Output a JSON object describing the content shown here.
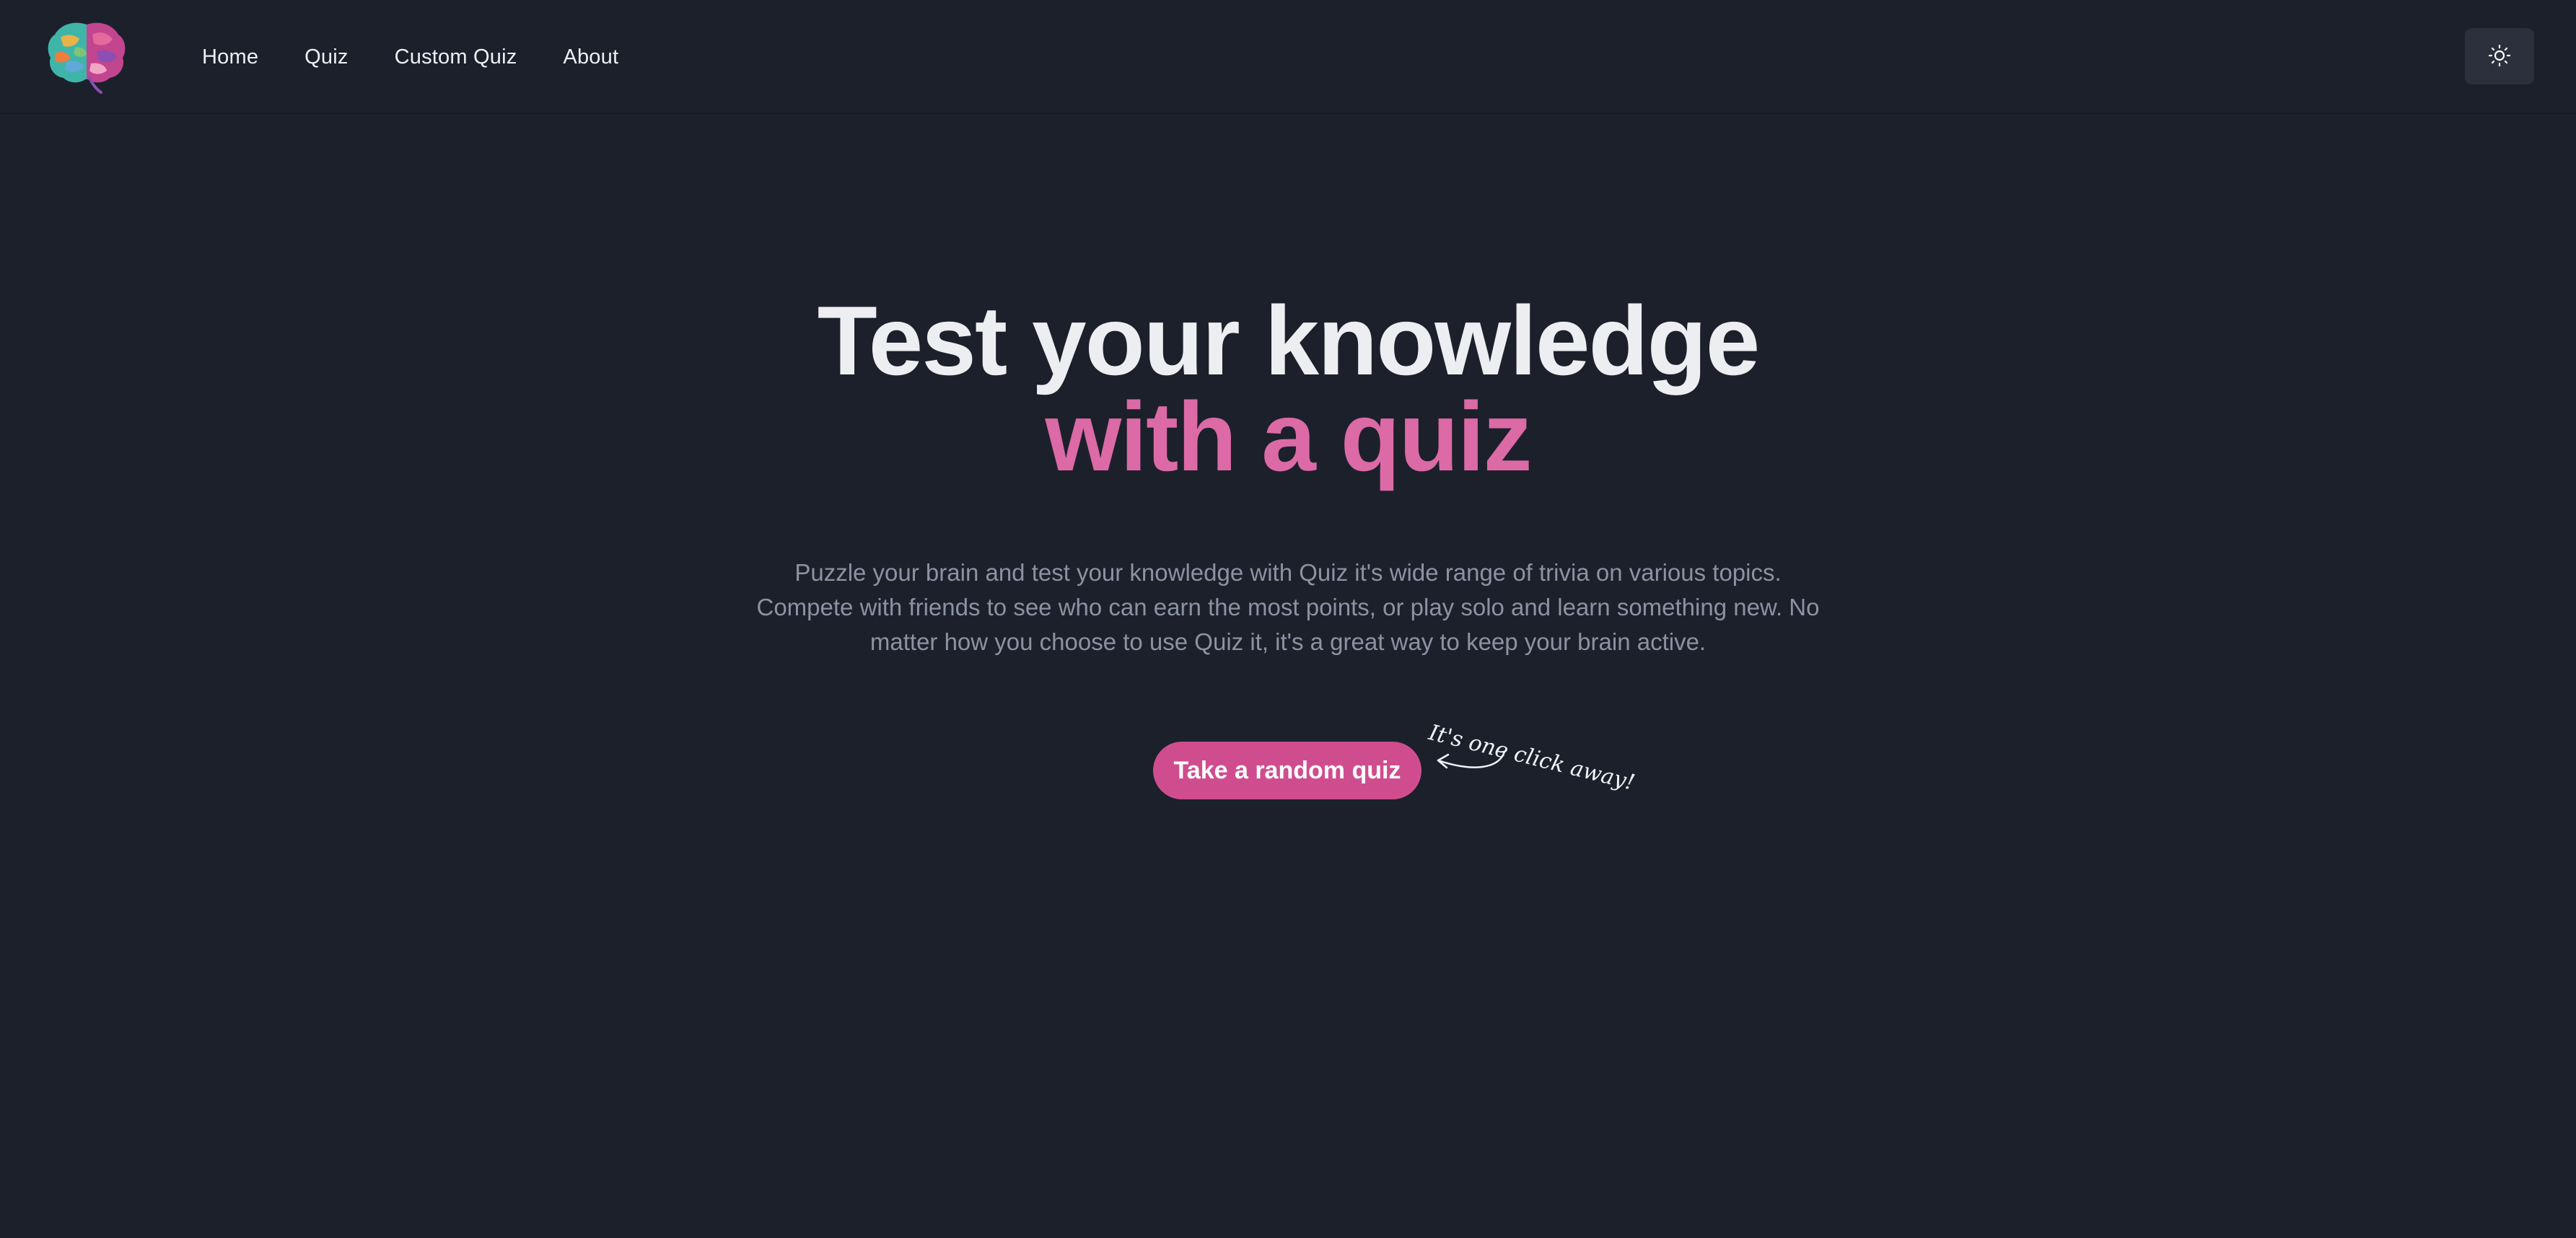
{
  "nav": {
    "logo_icon": "brain-icon",
    "links": [
      {
        "label": "Home"
      },
      {
        "label": "Quiz"
      },
      {
        "label": "Custom Quiz"
      },
      {
        "label": "About"
      }
    ],
    "theme_toggle_icon": "sun-icon"
  },
  "hero": {
    "title_line1": "Test your knowledge",
    "title_line2": "with a quiz",
    "description": "Puzzle your brain and test your knowledge with Quiz it's wide range of trivia on various topics. Compete with friends to see who can earn the most points, or play solo and learn something new. No matter how you choose to use Quiz it, it's a great way to keep your brain active.",
    "cta_label": "Take a random quiz",
    "note": "It's one click away!"
  },
  "colors": {
    "background": "#1c202b",
    "accent": "#cf4d8f",
    "accent_text": "#db6aa6",
    "muted_text": "#8b93a3"
  }
}
